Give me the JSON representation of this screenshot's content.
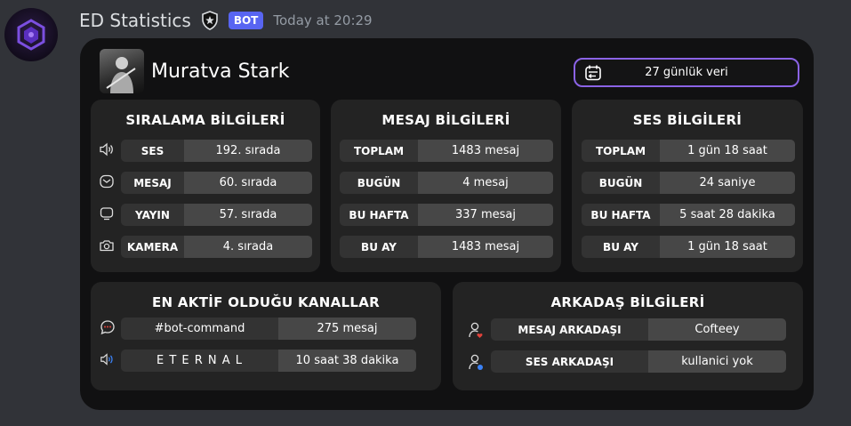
{
  "message": {
    "username": "ED Statistics",
    "bot_tag": "BOT",
    "timestamp": "Today at 20:29"
  },
  "card": {
    "profile_name": "Muratva Stark",
    "period_label": "27 günlük veri",
    "ranking": {
      "title": "SIRALAMA BİLGİLERİ",
      "rows": [
        {
          "icon": "speaker-icon",
          "label": "SES",
          "value": "192. sırada"
        },
        {
          "icon": "message-icon",
          "label": "MESAJ",
          "value": "60. sırada"
        },
        {
          "icon": "screen-icon",
          "label": "YAYIN",
          "value": "57. sırada"
        },
        {
          "icon": "camera-icon",
          "label": "KAMERA",
          "value": "4. sırada"
        }
      ]
    },
    "messages": {
      "title": "MESAJ BİLGİLERİ",
      "rows": [
        {
          "label": "TOPLAM",
          "value": "1483 mesaj"
        },
        {
          "label": "BUGÜN",
          "value": "4 mesaj"
        },
        {
          "label": "BU HAFTA",
          "value": "337 mesaj"
        },
        {
          "label": "BU AY",
          "value": "1483 mesaj"
        }
      ]
    },
    "voice": {
      "title": "SES BİLGİLERİ",
      "rows": [
        {
          "label": "TOPLAM",
          "value": "1 gün 18 saat"
        },
        {
          "label": "BUGÜN",
          "value": "24 saniye"
        },
        {
          "label": "BU HAFTA",
          "value": "5 saat 28 dakika"
        },
        {
          "label": "BU AY",
          "value": "1 gün 18 saat"
        }
      ]
    },
    "channels": {
      "title": "EN AKTİF OLDUĞU KANALLAR",
      "rows": [
        {
          "icon": "chat-bubble-icon",
          "label": "#bot-command",
          "value": "275 mesaj"
        },
        {
          "icon": "voice-channel-icon",
          "label": "E T E R N A L",
          "value": "10 saat 38 dakika"
        }
      ]
    },
    "friends": {
      "title": "ARKADAŞ BİLGİLERİ",
      "rows": [
        {
          "icon": "user-heart-icon",
          "label": "MESAJ ARKADAŞI",
          "value": "Cofteey"
        },
        {
          "icon": "user-voice-icon",
          "label": "SES ARKADAŞI",
          "value": "kullanici yok"
        }
      ]
    }
  },
  "colors": {
    "background": "#313338",
    "card": "#111112",
    "panel": "#232323",
    "key_cell": "#333333",
    "value_cell": "#474747",
    "accent": "#8b63e6",
    "bot_tag": "#5865f2",
    "heart_red": "#e0423a",
    "voice_blue": "#3b82f6"
  }
}
